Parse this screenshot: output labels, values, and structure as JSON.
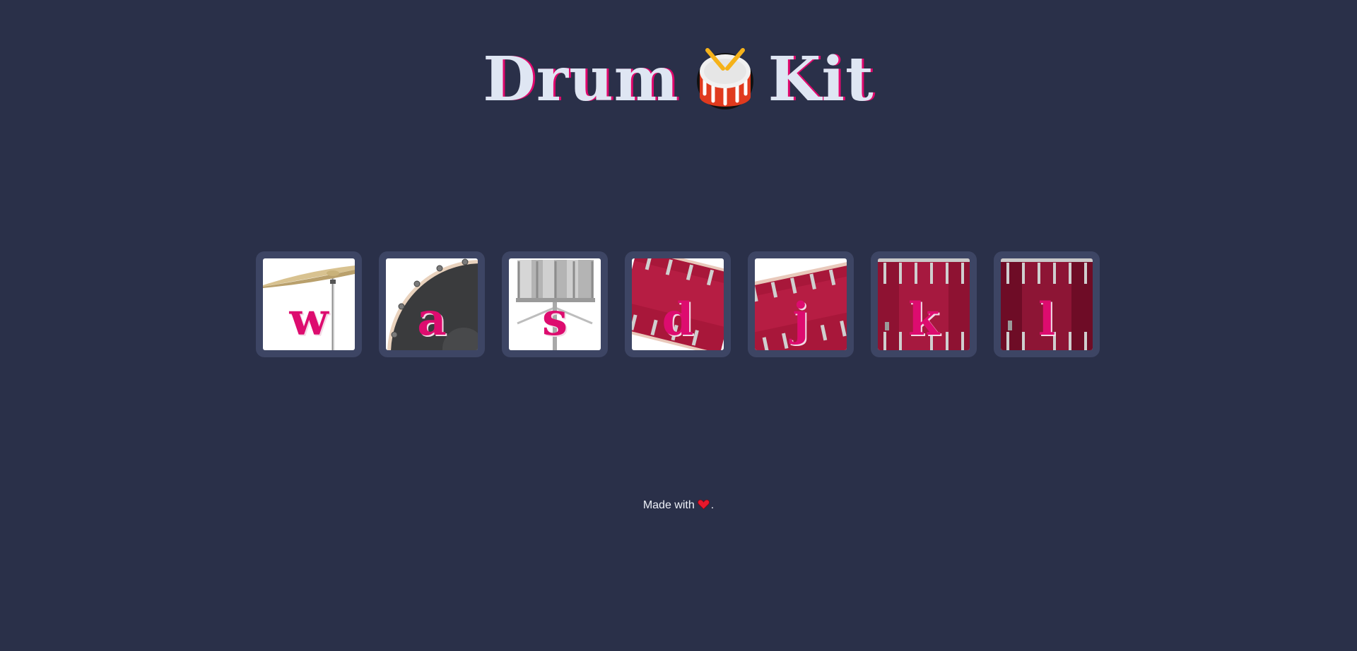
{
  "header": {
    "title_first": "Drum",
    "title_second": "Kit",
    "emoji_icon": "drum-icon"
  },
  "keys": [
    {
      "letter": "w",
      "instrument": "cymbal"
    },
    {
      "letter": "a",
      "instrument": "bass-drum"
    },
    {
      "letter": "s",
      "instrument": "snare-drum"
    },
    {
      "letter": "d",
      "instrument": "tom-tom"
    },
    {
      "letter": "j",
      "instrument": "tom-tom"
    },
    {
      "letter": "k",
      "instrument": "floor-tom"
    },
    {
      "letter": "l",
      "instrument": "floor-tom"
    }
  ],
  "footer": {
    "text_before": "Made with",
    "text_after": ".",
    "icon": "heart-icon"
  },
  "colors": {
    "background": "#2a3049",
    "key_frame": "#3d4564",
    "accent": "#dd0c6f",
    "title_text": "#dfe6f3"
  }
}
